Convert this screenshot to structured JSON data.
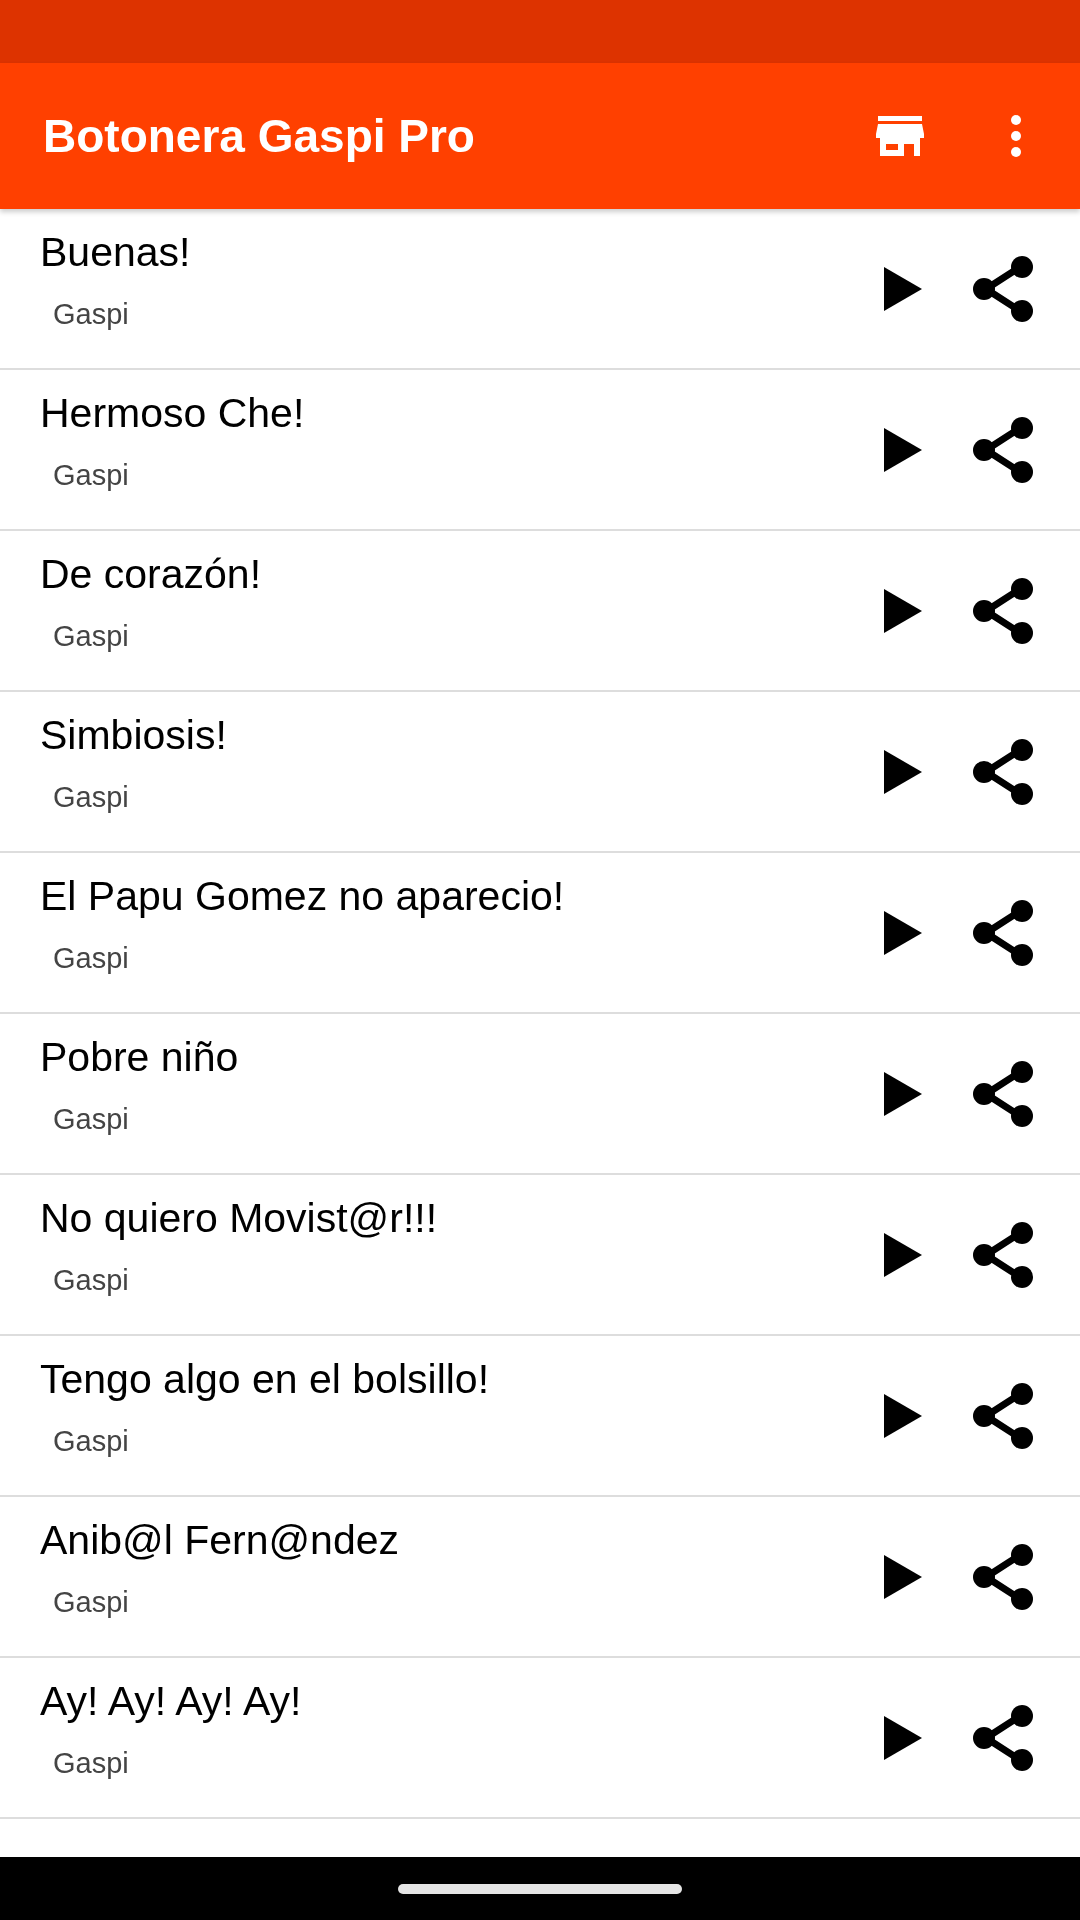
{
  "app_bar": {
    "title": "Botonera Gaspi Pro"
  },
  "sounds": [
    {
      "title": "Buenas!",
      "author": "Gaspi"
    },
    {
      "title": "Hermoso Che!",
      "author": "Gaspi"
    },
    {
      "title": "De corazón!",
      "author": "Gaspi"
    },
    {
      "title": "Simbiosis!",
      "author": "Gaspi"
    },
    {
      "title": "El Papu Gomez no aparecio!",
      "author": "Gaspi"
    },
    {
      "title": "Pobre niño",
      "author": "Gaspi"
    },
    {
      "title": "No quiero Movist@r!!!",
      "author": "Gaspi"
    },
    {
      "title": "Tengo algo en el bolsillo!",
      "author": "Gaspi"
    },
    {
      "title": "Anib@l Fern@ndez",
      "author": "Gaspi"
    },
    {
      "title": "Ay! Ay! Ay! Ay!",
      "author": "Gaspi"
    }
  ]
}
